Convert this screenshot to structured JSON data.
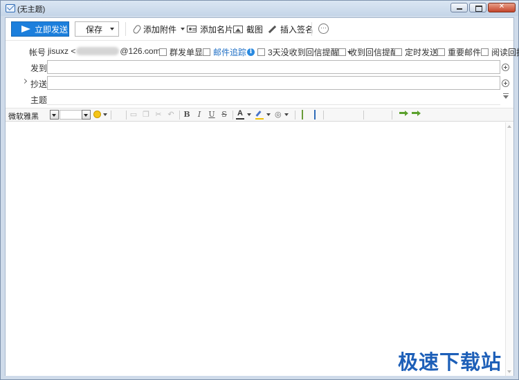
{
  "window": {
    "title": "(无主题)"
  },
  "toolbar": {
    "send_label": "立即发送",
    "save_label": "保存",
    "attach_label": "添加附件",
    "card_label": "添加名片",
    "screenshot_label": "截图",
    "signature_label": "插入签名"
  },
  "account": {
    "label": "帐号",
    "value_prefix": "jisuxz <",
    "value_suffix": "@126.com>"
  },
  "options": {
    "group_send": "群发单显",
    "mail_track": "邮件追踪",
    "no_reply_remind": "3天没收到回信提醒",
    "reply_remind": "收到回信提醒",
    "scheduled": "定时发送",
    "important": "重要邮件",
    "read_receipt": "阅读回执"
  },
  "fields": {
    "to_label": "发到",
    "cc_label": "抄送",
    "subject_label": "主题",
    "to_value": "",
    "cc_value": "",
    "subject_value": ""
  },
  "format": {
    "font_name": "微软雅黑",
    "bold": "B",
    "italic": "I",
    "underline": "U",
    "strike": "S",
    "font_color": "A"
  },
  "watermark": "极速下载站",
  "colors": {
    "send_button": "#1c7fdc",
    "link": "#1f6fc5",
    "watermark": "#1d5fb8"
  }
}
